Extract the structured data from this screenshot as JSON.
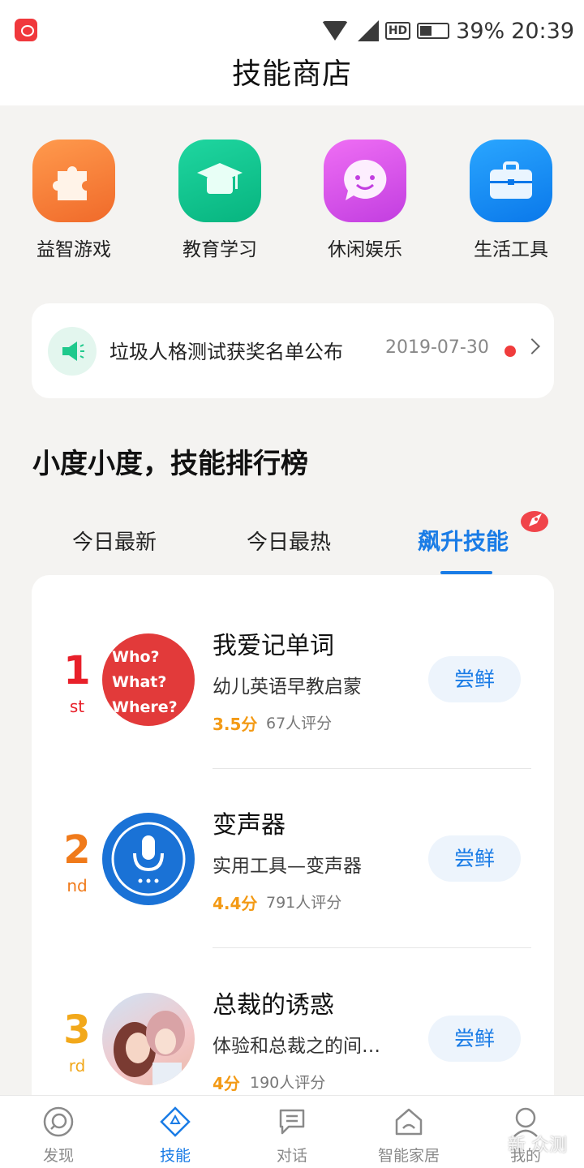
{
  "status_bar": {
    "battery": "39%",
    "time": "20:39",
    "hd_label": "HD"
  },
  "header": {
    "title": "技能商店"
  },
  "categories": [
    {
      "label": "益智游戏",
      "icon": "puzzle-icon"
    },
    {
      "label": "教育学习",
      "icon": "graduation-cap-icon"
    },
    {
      "label": "休闲娱乐",
      "icon": "smiley-chat-icon"
    },
    {
      "label": "生活工具",
      "icon": "briefcase-icon"
    }
  ],
  "notice": {
    "text": "垃圾人格测试获奖名单公布",
    "date": "2019-07-30"
  },
  "ranking": {
    "title": "小度小度，技能排行榜",
    "tabs": [
      {
        "label": "今日最新"
      },
      {
        "label": "今日最热"
      },
      {
        "label": "飙升技能",
        "active": true
      }
    ],
    "items": [
      {
        "rank": "1",
        "suffix": "st",
        "rank_color": "#e8202a",
        "name": "我爱记单词",
        "desc": "幼儿英语早教启蒙",
        "score": "3.5分",
        "count": "67人评分",
        "action": "尝鲜",
        "thumb_lines": [
          "Who?",
          "What?",
          "Where?"
        ]
      },
      {
        "rank": "2",
        "suffix": "nd",
        "rank_color": "#f07a1a",
        "name": "变声器",
        "desc": "实用工具—变声器",
        "score": "4.4分",
        "count": "791人评分",
        "action": "尝鲜"
      },
      {
        "rank": "3",
        "suffix": "rd",
        "rank_color": "#f2a81a",
        "name": "总裁的诱惑",
        "desc": "体验和总裁之的间…",
        "score": "4分",
        "count": "190人评分",
        "action": "尝鲜"
      }
    ]
  },
  "bottom_nav": [
    {
      "label": "发现",
      "icon": "discover-icon"
    },
    {
      "label": "技能",
      "icon": "skills-icon",
      "active": true
    },
    {
      "label": "对话",
      "icon": "chat-icon"
    },
    {
      "label": "智能家居",
      "icon": "smart-home-icon"
    },
    {
      "label": "我的",
      "icon": "profile-icon"
    }
  ],
  "watermark": "新 众测"
}
